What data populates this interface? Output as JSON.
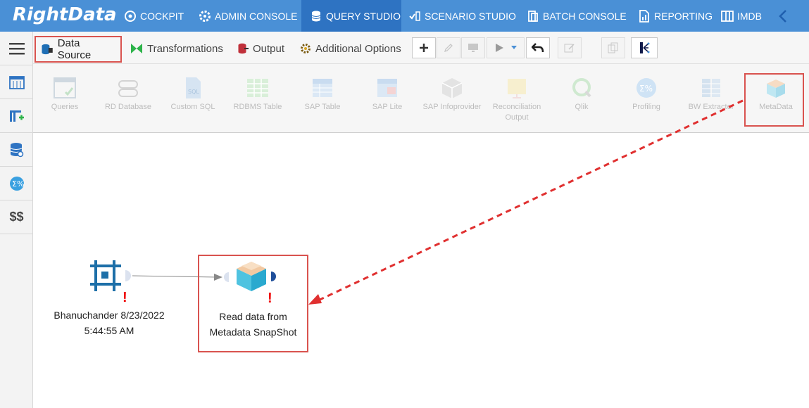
{
  "logo": "RightData",
  "nav": {
    "items": [
      {
        "label": "COCKPIT",
        "icon": "cockpit-icon"
      },
      {
        "label": "ADMIN CONSOLE",
        "icon": "gear-icon"
      },
      {
        "label": "QUERY STUDIO",
        "icon": "database-icon",
        "active": true
      },
      {
        "label": "SCENARIO STUDIO",
        "icon": "scenario-icon"
      },
      {
        "label": "BATCH CONSOLE",
        "icon": "batch-icon"
      },
      {
        "label": "REPORTING",
        "icon": "report-icon"
      },
      {
        "label": "IMDB",
        "icon": "imdb-icon"
      }
    ]
  },
  "sidebar": {
    "money_label": "$$"
  },
  "toolbar": {
    "tabs": [
      {
        "label": "Data Source",
        "icon": "database-plug-icon"
      },
      {
        "label": "Transformations",
        "icon": "bowtie-icon"
      },
      {
        "label": "Output",
        "icon": "output-icon"
      },
      {
        "label": "Additional Options",
        "icon": "gear-icon"
      }
    ]
  },
  "palette": {
    "items": [
      {
        "label": "Queries"
      },
      {
        "label": "RD Database"
      },
      {
        "label": "Custom SQL"
      },
      {
        "label": "RDBMS Table"
      },
      {
        "label": "SAP Table"
      },
      {
        "label": "SAP Lite"
      },
      {
        "label": "SAP Infoprovider"
      },
      {
        "label": "Reconciliation Output"
      },
      {
        "label": "Qlik"
      },
      {
        "label": "Profiling"
      },
      {
        "label": "BW Extractor"
      },
      {
        "label": "MetaData"
      }
    ]
  },
  "canvas": {
    "node1": {
      "line1": "Bhanuchander 8/23/2022",
      "line2": "5:44:55 AM",
      "warning": "!"
    },
    "node2": {
      "line1": "Read data from",
      "line2": "Metadata SnapShot",
      "warning": "!"
    }
  }
}
